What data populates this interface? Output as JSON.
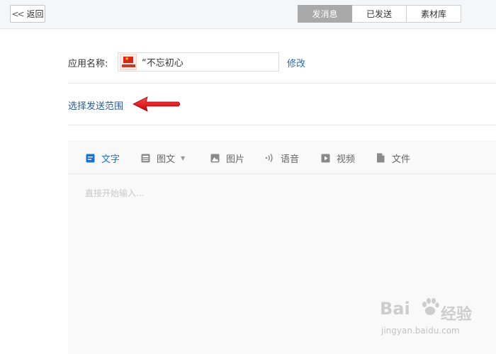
{
  "topbar": {
    "back_label": "返回",
    "tabs": [
      {
        "label": "发消息",
        "active": true
      },
      {
        "label": "已发送",
        "active": false
      },
      {
        "label": "素材库",
        "active": false
      }
    ]
  },
  "app": {
    "label": "应用名称:",
    "name": "“不忘初心",
    "modify_label": "修改"
  },
  "scope": {
    "label": "选择发送范围"
  },
  "editor": {
    "tools": [
      {
        "label": "文字",
        "icon": "text-icon",
        "active": true
      },
      {
        "label": "图文",
        "icon": "news-icon",
        "active": false
      },
      {
        "label": "图片",
        "icon": "image-icon",
        "active": false
      },
      {
        "label": "语音",
        "icon": "voice-icon",
        "active": false
      },
      {
        "label": "视频",
        "icon": "video-icon",
        "active": false
      },
      {
        "label": "文件",
        "icon": "file-icon",
        "active": false
      }
    ],
    "placeholder": "直接开始输入..."
  },
  "watermark": {
    "brand": "Bai",
    "brand_suffix": "经验",
    "url": "jingyan.baidu.com"
  },
  "colors": {
    "link": "#2a6cb0",
    "active_tool": "#1e6fd0",
    "active_tab_bg": "#a9a9a9",
    "annotation_arrow": "#e8101a"
  }
}
